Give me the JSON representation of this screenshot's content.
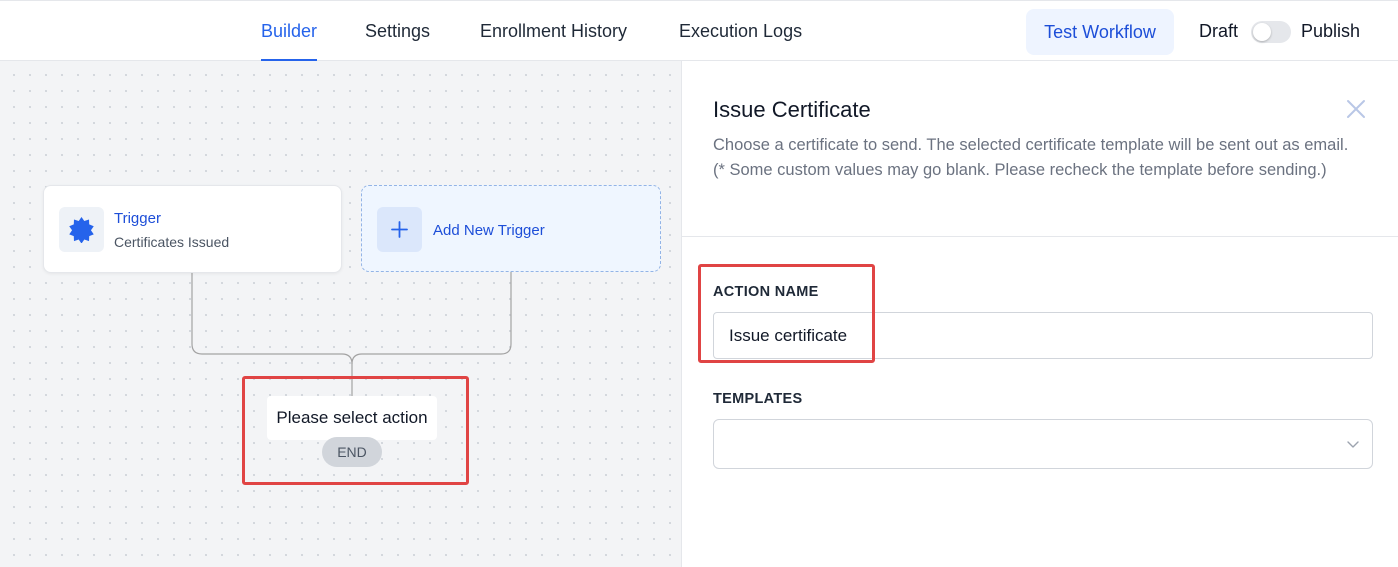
{
  "nav": {
    "tabs": [
      {
        "label": "Builder",
        "active": true
      },
      {
        "label": "Settings",
        "active": false
      },
      {
        "label": "Enrollment History",
        "active": false
      },
      {
        "label": "Execution Logs",
        "active": false
      }
    ],
    "test_workflow_label": "Test Workflow",
    "draft_label": "Draft",
    "publish_label": "Publish",
    "publish_toggle_on": false
  },
  "canvas": {
    "trigger": {
      "title": "Trigger",
      "subtitle": "Certificates Issued",
      "icon": "certificate-badge-icon"
    },
    "add_trigger": {
      "label": "Add New Trigger",
      "icon": "plus-icon"
    },
    "action_placeholder": "Please select action",
    "end_label": "END"
  },
  "panel": {
    "title": "Issue Certificate",
    "description": "Choose a certificate to send. The selected certificate template will be sent out as email. (* Some custom values may go blank. Please recheck the template before sending.)",
    "action_name": {
      "label": "ACTION NAME",
      "value": "Issue certificate"
    },
    "templates": {
      "label": "TEMPLATES",
      "value": ""
    }
  },
  "colors": {
    "accent": "#2563eb",
    "highlight": "#e04444",
    "canvas_bg": "#f3f4f6"
  }
}
